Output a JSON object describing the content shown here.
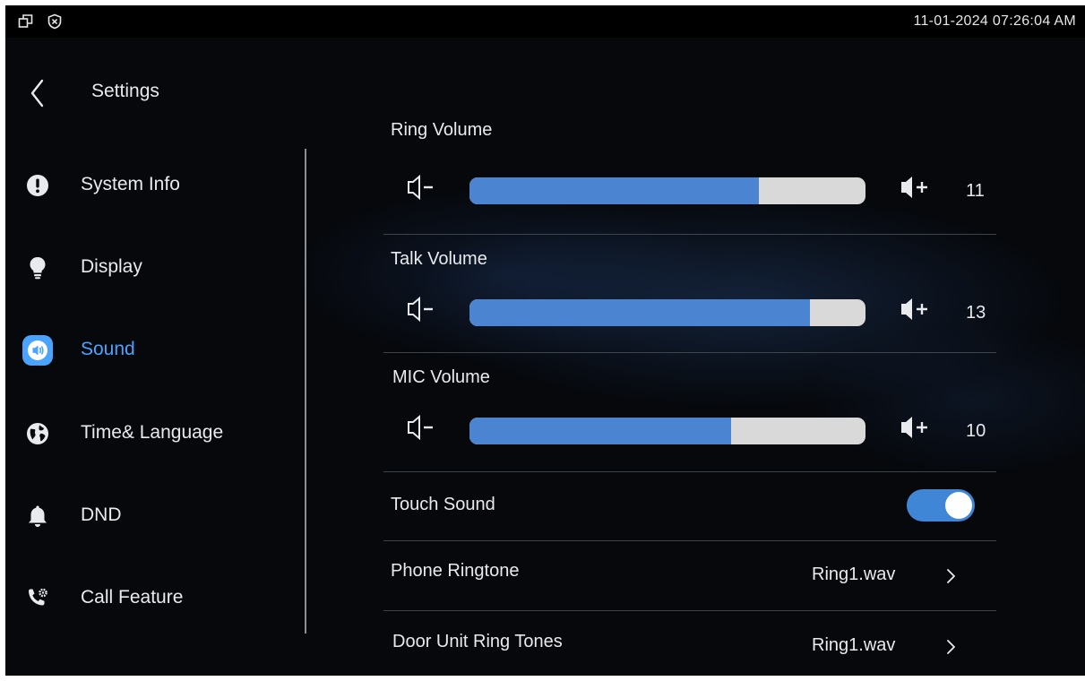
{
  "status_bar": {
    "datetime": "11-01-2024 07:26:04 AM",
    "icons": [
      "window-restore-icon",
      "shield-close-icon"
    ]
  },
  "header": {
    "title": "Settings",
    "back_icon": "chevron-left-icon"
  },
  "sidebar": {
    "items": [
      {
        "label": "System Info",
        "icon": "info-exclamation-icon",
        "active": false
      },
      {
        "label": "Display",
        "icon": "lightbulb-icon",
        "active": false
      },
      {
        "label": "Sound",
        "icon": "speaker-icon",
        "active": true
      },
      {
        "label": "Time& Language",
        "icon": "globe-icon",
        "active": false
      },
      {
        "label": "DND",
        "icon": "bell-icon",
        "active": false
      },
      {
        "label": "Call Feature",
        "icon": "phone-gear-icon",
        "active": false
      }
    ]
  },
  "sound": {
    "ring_volume": {
      "label": "Ring Volume",
      "value": "11",
      "level_fraction": 0.73
    },
    "talk_volume": {
      "label": "Talk Volume",
      "value": "13",
      "level_fraction": 0.86
    },
    "mic_volume": {
      "label": "MIC Volume",
      "value": "10",
      "level_fraction": 0.66
    },
    "touch_sound": {
      "label": "Touch Sound",
      "enabled": true
    },
    "phone_ringtone": {
      "label": "Phone Ringtone",
      "value": "Ring1.wav"
    },
    "door_unit_ring_tones": {
      "label": "Door Unit Ring Tones",
      "value": "Ring1.wav"
    }
  },
  "colors": {
    "accent": "#4aa3ff",
    "slider_fill": "#4b84d0",
    "slider_track": "#d9d9d9",
    "toggle_on": "#3f86d6",
    "background": "#06080c"
  }
}
